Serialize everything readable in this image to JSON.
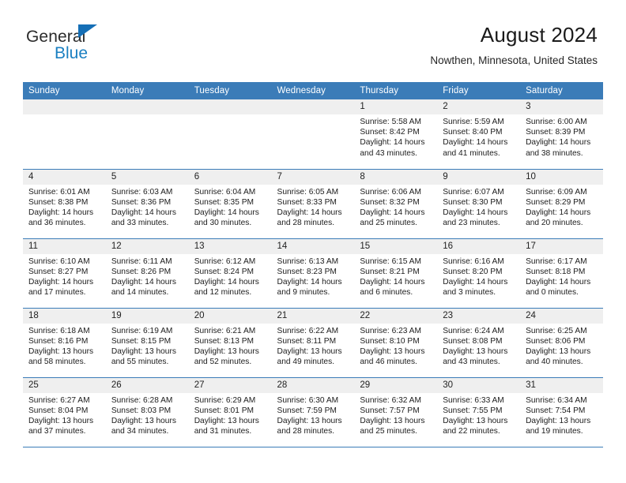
{
  "logo": {
    "word1": "General",
    "word2": "Blue",
    "triangle_color": "#156fb6",
    "word2_color": "#1a7fc1"
  },
  "header": {
    "title": "August 2024",
    "subtitle": "Nowthen, Minnesota, United States",
    "accent_color": "#3b7cb8"
  },
  "calendar": {
    "weekdays": [
      "Sunday",
      "Monday",
      "Tuesday",
      "Wednesday",
      "Thursday",
      "Friday",
      "Saturday"
    ],
    "weeks": [
      [
        {
          "day": "",
          "empty": true
        },
        {
          "day": "",
          "empty": true
        },
        {
          "day": "",
          "empty": true
        },
        {
          "day": "",
          "empty": true
        },
        {
          "day": "1",
          "sunrise": "Sunrise: 5:58 AM",
          "sunset": "Sunset: 8:42 PM",
          "daylight": "Daylight: 14 hours and 43 minutes."
        },
        {
          "day": "2",
          "sunrise": "Sunrise: 5:59 AM",
          "sunset": "Sunset: 8:40 PM",
          "daylight": "Daylight: 14 hours and 41 minutes."
        },
        {
          "day": "3",
          "sunrise": "Sunrise: 6:00 AM",
          "sunset": "Sunset: 8:39 PM",
          "daylight": "Daylight: 14 hours and 38 minutes."
        }
      ],
      [
        {
          "day": "4",
          "sunrise": "Sunrise: 6:01 AM",
          "sunset": "Sunset: 8:38 PM",
          "daylight": "Daylight: 14 hours and 36 minutes."
        },
        {
          "day": "5",
          "sunrise": "Sunrise: 6:03 AM",
          "sunset": "Sunset: 8:36 PM",
          "daylight": "Daylight: 14 hours and 33 minutes."
        },
        {
          "day": "6",
          "sunrise": "Sunrise: 6:04 AM",
          "sunset": "Sunset: 8:35 PM",
          "daylight": "Daylight: 14 hours and 30 minutes."
        },
        {
          "day": "7",
          "sunrise": "Sunrise: 6:05 AM",
          "sunset": "Sunset: 8:33 PM",
          "daylight": "Daylight: 14 hours and 28 minutes."
        },
        {
          "day": "8",
          "sunrise": "Sunrise: 6:06 AM",
          "sunset": "Sunset: 8:32 PM",
          "daylight": "Daylight: 14 hours and 25 minutes."
        },
        {
          "day": "9",
          "sunrise": "Sunrise: 6:07 AM",
          "sunset": "Sunset: 8:30 PM",
          "daylight": "Daylight: 14 hours and 23 minutes."
        },
        {
          "day": "10",
          "sunrise": "Sunrise: 6:09 AM",
          "sunset": "Sunset: 8:29 PM",
          "daylight": "Daylight: 14 hours and 20 minutes."
        }
      ],
      [
        {
          "day": "11",
          "sunrise": "Sunrise: 6:10 AM",
          "sunset": "Sunset: 8:27 PM",
          "daylight": "Daylight: 14 hours and 17 minutes."
        },
        {
          "day": "12",
          "sunrise": "Sunrise: 6:11 AM",
          "sunset": "Sunset: 8:26 PM",
          "daylight": "Daylight: 14 hours and 14 minutes."
        },
        {
          "day": "13",
          "sunrise": "Sunrise: 6:12 AM",
          "sunset": "Sunset: 8:24 PM",
          "daylight": "Daylight: 14 hours and 12 minutes."
        },
        {
          "day": "14",
          "sunrise": "Sunrise: 6:13 AM",
          "sunset": "Sunset: 8:23 PM",
          "daylight": "Daylight: 14 hours and 9 minutes."
        },
        {
          "day": "15",
          "sunrise": "Sunrise: 6:15 AM",
          "sunset": "Sunset: 8:21 PM",
          "daylight": "Daylight: 14 hours and 6 minutes."
        },
        {
          "day": "16",
          "sunrise": "Sunrise: 6:16 AM",
          "sunset": "Sunset: 8:20 PM",
          "daylight": "Daylight: 14 hours and 3 minutes."
        },
        {
          "day": "17",
          "sunrise": "Sunrise: 6:17 AM",
          "sunset": "Sunset: 8:18 PM",
          "daylight": "Daylight: 14 hours and 0 minutes."
        }
      ],
      [
        {
          "day": "18",
          "sunrise": "Sunrise: 6:18 AM",
          "sunset": "Sunset: 8:16 PM",
          "daylight": "Daylight: 13 hours and 58 minutes."
        },
        {
          "day": "19",
          "sunrise": "Sunrise: 6:19 AM",
          "sunset": "Sunset: 8:15 PM",
          "daylight": "Daylight: 13 hours and 55 minutes."
        },
        {
          "day": "20",
          "sunrise": "Sunrise: 6:21 AM",
          "sunset": "Sunset: 8:13 PM",
          "daylight": "Daylight: 13 hours and 52 minutes."
        },
        {
          "day": "21",
          "sunrise": "Sunrise: 6:22 AM",
          "sunset": "Sunset: 8:11 PM",
          "daylight": "Daylight: 13 hours and 49 minutes."
        },
        {
          "day": "22",
          "sunrise": "Sunrise: 6:23 AM",
          "sunset": "Sunset: 8:10 PM",
          "daylight": "Daylight: 13 hours and 46 minutes."
        },
        {
          "day": "23",
          "sunrise": "Sunrise: 6:24 AM",
          "sunset": "Sunset: 8:08 PM",
          "daylight": "Daylight: 13 hours and 43 minutes."
        },
        {
          "day": "24",
          "sunrise": "Sunrise: 6:25 AM",
          "sunset": "Sunset: 8:06 PM",
          "daylight": "Daylight: 13 hours and 40 minutes."
        }
      ],
      [
        {
          "day": "25",
          "sunrise": "Sunrise: 6:27 AM",
          "sunset": "Sunset: 8:04 PM",
          "daylight": "Daylight: 13 hours and 37 minutes."
        },
        {
          "day": "26",
          "sunrise": "Sunrise: 6:28 AM",
          "sunset": "Sunset: 8:03 PM",
          "daylight": "Daylight: 13 hours and 34 minutes."
        },
        {
          "day": "27",
          "sunrise": "Sunrise: 6:29 AM",
          "sunset": "Sunset: 8:01 PM",
          "daylight": "Daylight: 13 hours and 31 minutes."
        },
        {
          "day": "28",
          "sunrise": "Sunrise: 6:30 AM",
          "sunset": "Sunset: 7:59 PM",
          "daylight": "Daylight: 13 hours and 28 minutes."
        },
        {
          "day": "29",
          "sunrise": "Sunrise: 6:32 AM",
          "sunset": "Sunset: 7:57 PM",
          "daylight": "Daylight: 13 hours and 25 minutes."
        },
        {
          "day": "30",
          "sunrise": "Sunrise: 6:33 AM",
          "sunset": "Sunset: 7:55 PM",
          "daylight": "Daylight: 13 hours and 22 minutes."
        },
        {
          "day": "31",
          "sunrise": "Sunrise: 6:34 AM",
          "sunset": "Sunset: 7:54 PM",
          "daylight": "Daylight: 13 hours and 19 minutes."
        }
      ]
    ]
  }
}
